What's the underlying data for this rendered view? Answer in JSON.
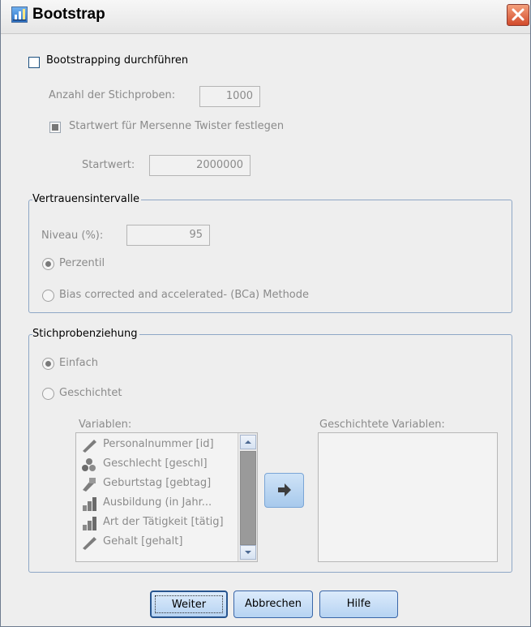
{
  "window": {
    "title": "Bootstrap",
    "icon": "bootstrap-app-icon",
    "close_icon": "close-icon"
  },
  "perform": {
    "label": "Bootstrapping durchführen",
    "mnemonic": "p",
    "checked": false
  },
  "samples": {
    "label": "Anzahl der Stichproben:",
    "value": "1000"
  },
  "seed": {
    "checkbox_label": "Startwert für Mersenne Twister festlegen",
    "label": "Startwert:",
    "value": "2000000"
  },
  "confidence": {
    "title": "Vertrauensintervalle",
    "level_label": "Niveau (%):",
    "level_value": "95",
    "options": [
      {
        "label": "Perzentil",
        "selected": true
      },
      {
        "label": "Bias corrected and accelerated- (BCa) Methode",
        "selected": false
      }
    ]
  },
  "sampling": {
    "title": "Stichprobenziehung",
    "options": [
      {
        "label": "Einfach",
        "selected": true
      },
      {
        "label": "Geschichtet",
        "selected": false
      }
    ],
    "variables_label": "Variablen:",
    "stratified_label": "Geschichtete Variablen:",
    "variables": [
      {
        "label": "Personalnummer [id]",
        "icon": "scale-ruler-icon"
      },
      {
        "label": "Geschlecht [geschl]",
        "icon": "nominal-shapes-icon"
      },
      {
        "label": "Geburtstag [gebtag]",
        "icon": "date-scale-icon"
      },
      {
        "label": "Ausbildung (in Jahr...",
        "icon": "ordinal-bars-icon"
      },
      {
        "label": "Art der Tätigkeit [tätig]",
        "icon": "ordinal-bars-icon"
      },
      {
        "label": "Gehalt [gehalt]",
        "icon": "scale-ruler-icon"
      }
    ],
    "move_icon": "arrow-right-icon"
  },
  "buttons": {
    "ok": "Weiter",
    "cancel": "Abbrechen",
    "help": "Hilfe"
  },
  "colors": {
    "accent": "#3a66a8",
    "disabled_text": "#8b8b8b",
    "group_border": "#8ea7c6"
  }
}
